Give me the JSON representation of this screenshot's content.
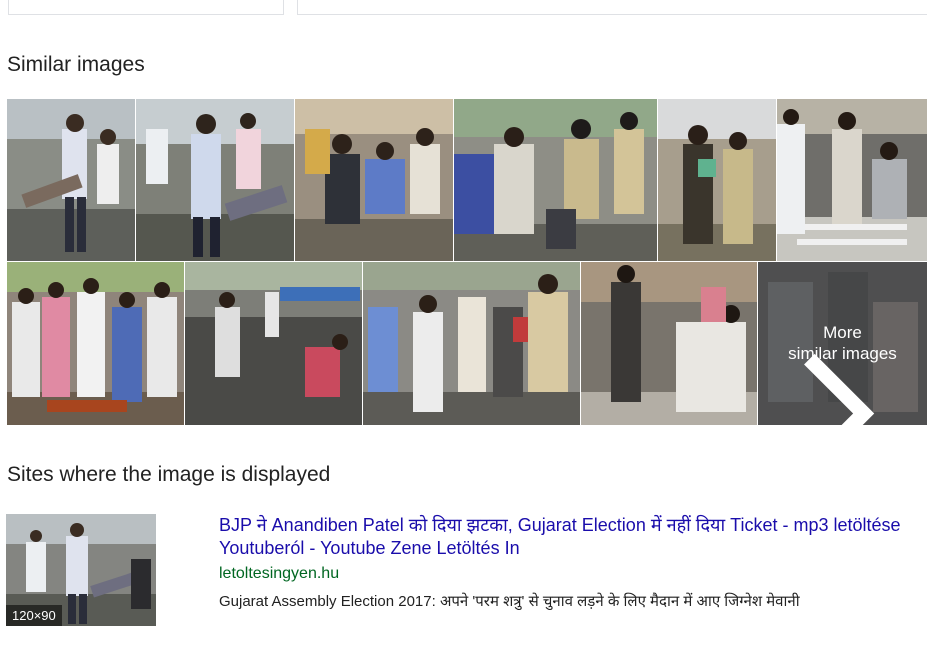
{
  "similar_images": {
    "heading": "Similar images",
    "more_label_line1": "More",
    "more_label_line2": "similar images"
  },
  "sites": {
    "heading": "Sites where the image is displayed",
    "result": {
      "title": "BJP ने Anandiben Patel को दिया झटका, Gujarat Election में नहीं दिया Ticket - mp3 letöltése Youtuberól - Youtube Zene Letöltés In",
      "url": "letoltesingyen.hu",
      "snippet": "Gujarat Assembly Election 2017: अपने 'परम शत्रु' से चुनाव लड़ने के लिए मैदान में आए जिग्नेश मेवानी",
      "thumb_size": "120×90"
    }
  },
  "colors": {
    "link": "#1a0dab",
    "url_green": "#006621"
  }
}
